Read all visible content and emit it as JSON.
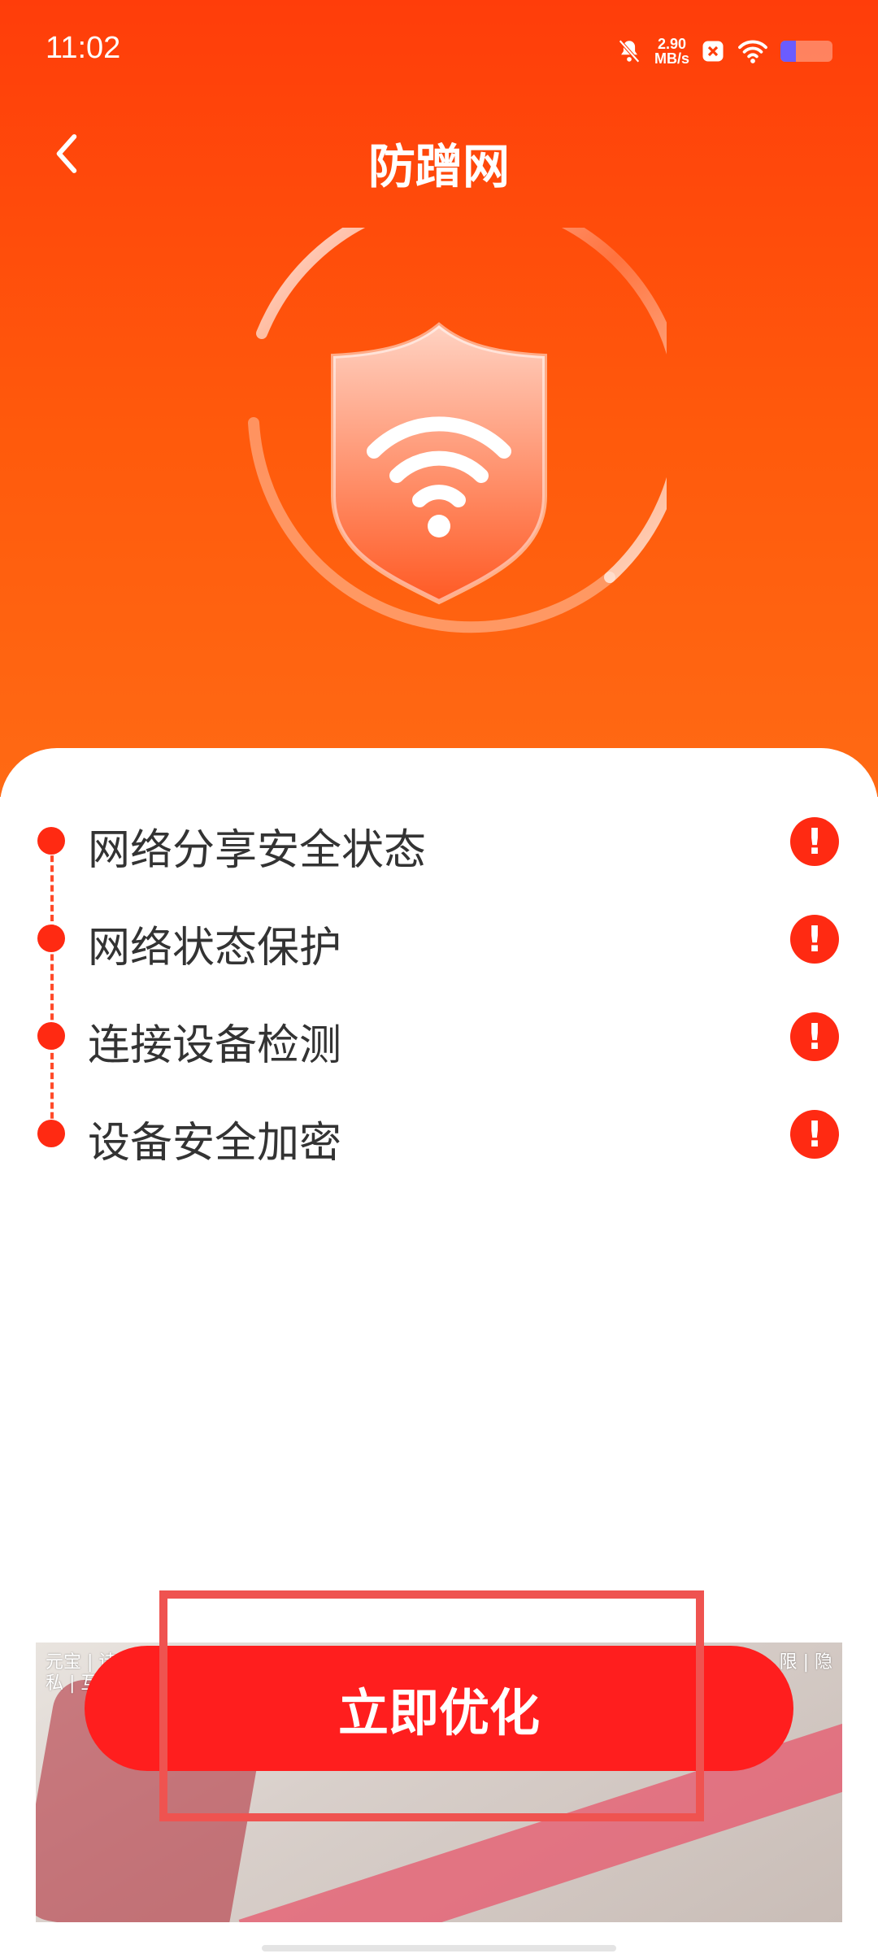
{
  "status_bar": {
    "time": "11:02",
    "net_speed_value": "2.90",
    "net_speed_unit": "MB/s",
    "battery_level": 0.3
  },
  "header": {
    "title": "防蹭网"
  },
  "checks": [
    {
      "label": "网络分享安全状态",
      "status": "warning"
    },
    {
      "label": "网络状态保护",
      "status": "warning"
    },
    {
      "label": "连接设备检测",
      "status": "warning"
    },
    {
      "label": "设备安全加密",
      "status": "warning"
    }
  ],
  "ad": {
    "text_left": "元宝 | 诗\n私 | 互",
    "text_right": "限 | 隐"
  },
  "cta": {
    "label": "立即优化"
  },
  "colors": {
    "accent": "#ff3d0a",
    "button": "#ff1e1e",
    "warn": "#ff2a12",
    "highlight": "#ef5350"
  }
}
